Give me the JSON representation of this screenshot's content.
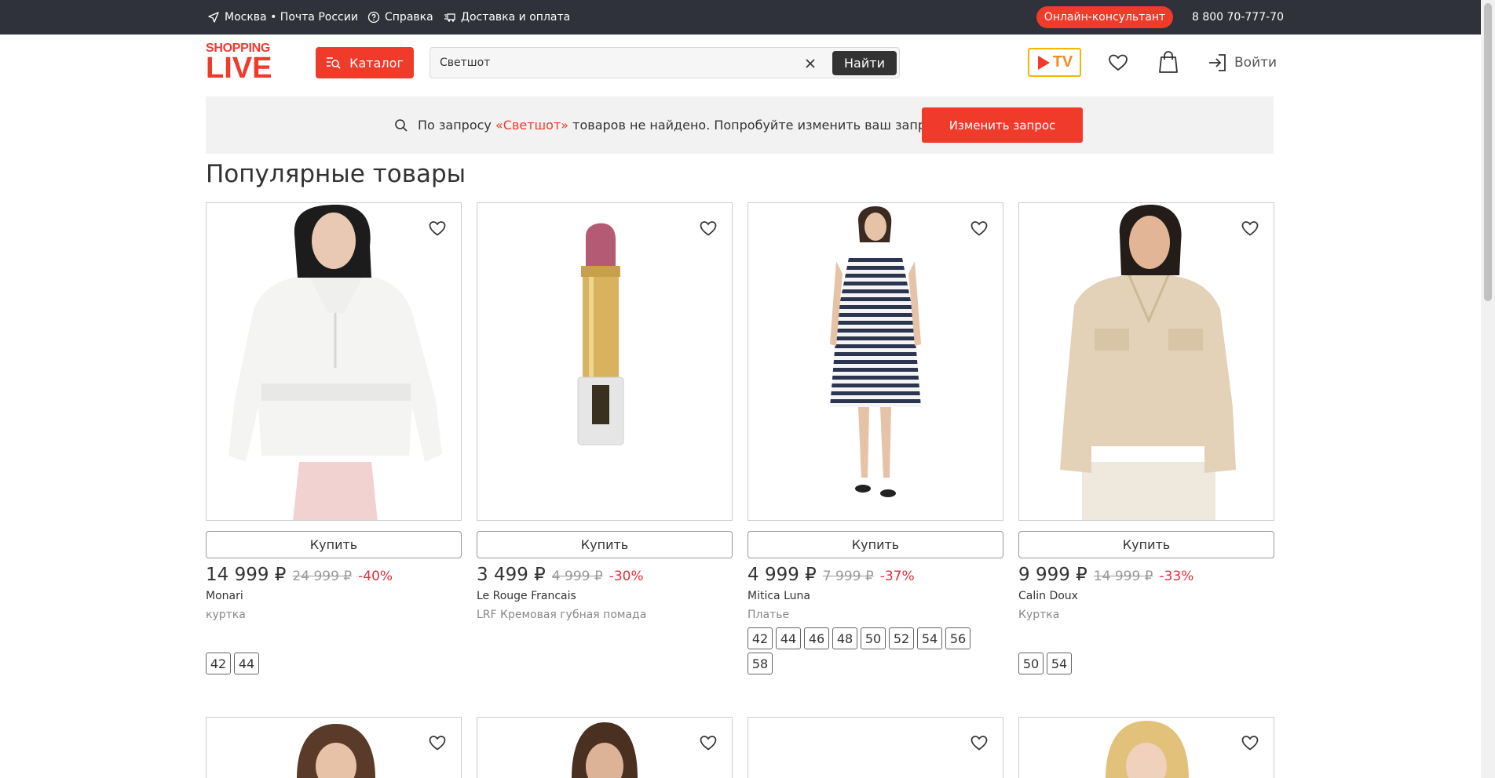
{
  "topbar": {
    "location": "Москва • Почта России",
    "help": "Справка",
    "delivery": "Доставка и оплата",
    "consultant": "Онлайн-консультант",
    "phone": "8 800 70-777-70"
  },
  "header": {
    "logo_line1": "SHOPPING",
    "logo_line2": "LIVE",
    "catalog": "Каталог",
    "search_value": "Светшот",
    "search_button": "Найти",
    "tv_label": "TV",
    "login": "Войти"
  },
  "notfound": {
    "prefix": "По запросу",
    "query": "«Светшот»",
    "suffix": "товаров не найдено. Попробуйте изменить ваш запрос",
    "button": "Изменить запрос"
  },
  "section_title": "Популярные товары",
  "buy_label": "Купить",
  "products": [
    {
      "price": "14 999 ₽",
      "old_price": "24 999 ₽",
      "discount": "-40%",
      "brand": "Monari",
      "desc": "куртка",
      "sizes": [
        "42",
        "44"
      ]
    },
    {
      "price": "3 499 ₽",
      "old_price": "4 999 ₽",
      "discount": "-30%",
      "brand": "Le Rouge Francais",
      "desc": "LRF Кремовая губная помада",
      "sizes": []
    },
    {
      "price": "4 999 ₽",
      "old_price": "7 999 ₽",
      "discount": "-37%",
      "brand": "Mitica Luna",
      "desc": "Платье",
      "sizes": [
        "42",
        "44",
        "46",
        "48",
        "50",
        "52",
        "54",
        "56",
        "58"
      ]
    },
    {
      "price": "9 999 ₽",
      "old_price": "14 999 ₽",
      "discount": "-33%",
      "brand": "Calin Doux",
      "desc": "Куртка",
      "sizes": [
        "50",
        "54"
      ]
    }
  ],
  "colors": {
    "accent": "#f03b2b",
    "topbar": "#2f323a",
    "discount": "#e0303b"
  }
}
